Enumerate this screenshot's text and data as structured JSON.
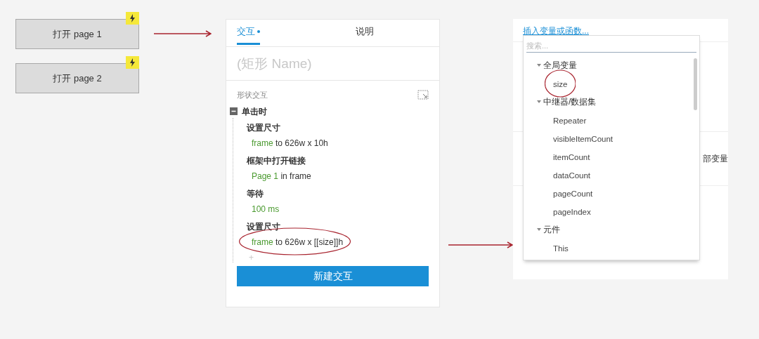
{
  "left_buttons": [
    {
      "label": "打开 page 1"
    },
    {
      "label": "打开 page 2"
    }
  ],
  "panel": {
    "tabs": [
      {
        "label": "交互",
        "selected": true,
        "modified": true
      },
      {
        "label": "说明",
        "selected": false,
        "modified": false
      }
    ],
    "name_placeholder": "(矩形 Name)",
    "section_title": "形状交互",
    "event": {
      "label": "单击时",
      "expanded": true
    },
    "actions": [
      {
        "title": "设置尺寸",
        "target": "frame",
        "detail": "to 626w x 10h",
        "circled": false
      },
      {
        "title": "框架中打开链接",
        "target": "Page 1",
        "detail": "in frame",
        "circled": false
      },
      {
        "title": "等待",
        "target": "100 ms",
        "circled": false
      },
      {
        "title": "设置尺寸",
        "target": "frame",
        "detail": "to 626w x [[size]]h",
        "circled": true
      }
    ],
    "add": "+",
    "new_button": "新建交互"
  },
  "right": {
    "link": "插入变量或函数...",
    "behind_text": "部变量",
    "dropdown": {
      "search_placeholder": "搜索...",
      "groups": [
        {
          "label": "全局变量",
          "expanded": true,
          "children": [
            {
              "label": "size",
              "circled": true
            }
          ]
        },
        {
          "label": "中继器/数据集",
          "expanded": true,
          "children": [
            {
              "label": "Repeater",
              "circled": false
            },
            {
              "label": "visibleItemCount",
              "circled": false
            },
            {
              "label": "itemCount",
              "circled": false
            },
            {
              "label": "dataCount",
              "circled": false
            },
            {
              "label": "pageCount",
              "circled": false
            },
            {
              "label": "pageIndex",
              "circled": false
            }
          ]
        },
        {
          "label": "元件",
          "expanded": true,
          "children": [
            {
              "label": "This",
              "circled": false
            }
          ]
        }
      ]
    }
  }
}
